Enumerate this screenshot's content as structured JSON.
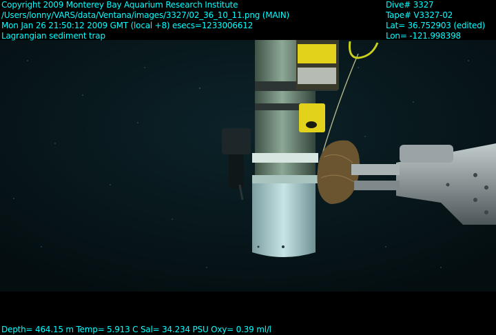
{
  "overlay": {
    "left_lines": [
      "Copyright 2009 Monterey Bay Aquarium Research Institute",
      "/Users/lonny/VARS/data/Ventana/images/3327/02_36_10_11.png (MAIN)",
      "Mon Jan 26 21:50:12 2009 GMT (local +8)  esecs=1233006612",
      "Lagrangian sediment trap"
    ],
    "right_lines": [
      "Dive# 3327",
      "Tape# V3327-02",
      "Lat= 36.752903 (edited)",
      "Lon= -121.998398"
    ],
    "bottom_line": "Depth= 464.15 m  Temp= 5.913 C  Sal= 34.234 PSU  Oxy= 0.39 ml/l",
    "text_color": "#00ffff"
  },
  "scene": {
    "water_color": "#07171d",
    "trap_color": "#7e9a88",
    "trap_base_color": "#b3d2d4",
    "float_color": "#e2d21c",
    "bag_color": "#6b5531",
    "manipulator_color": "#8e989a"
  }
}
